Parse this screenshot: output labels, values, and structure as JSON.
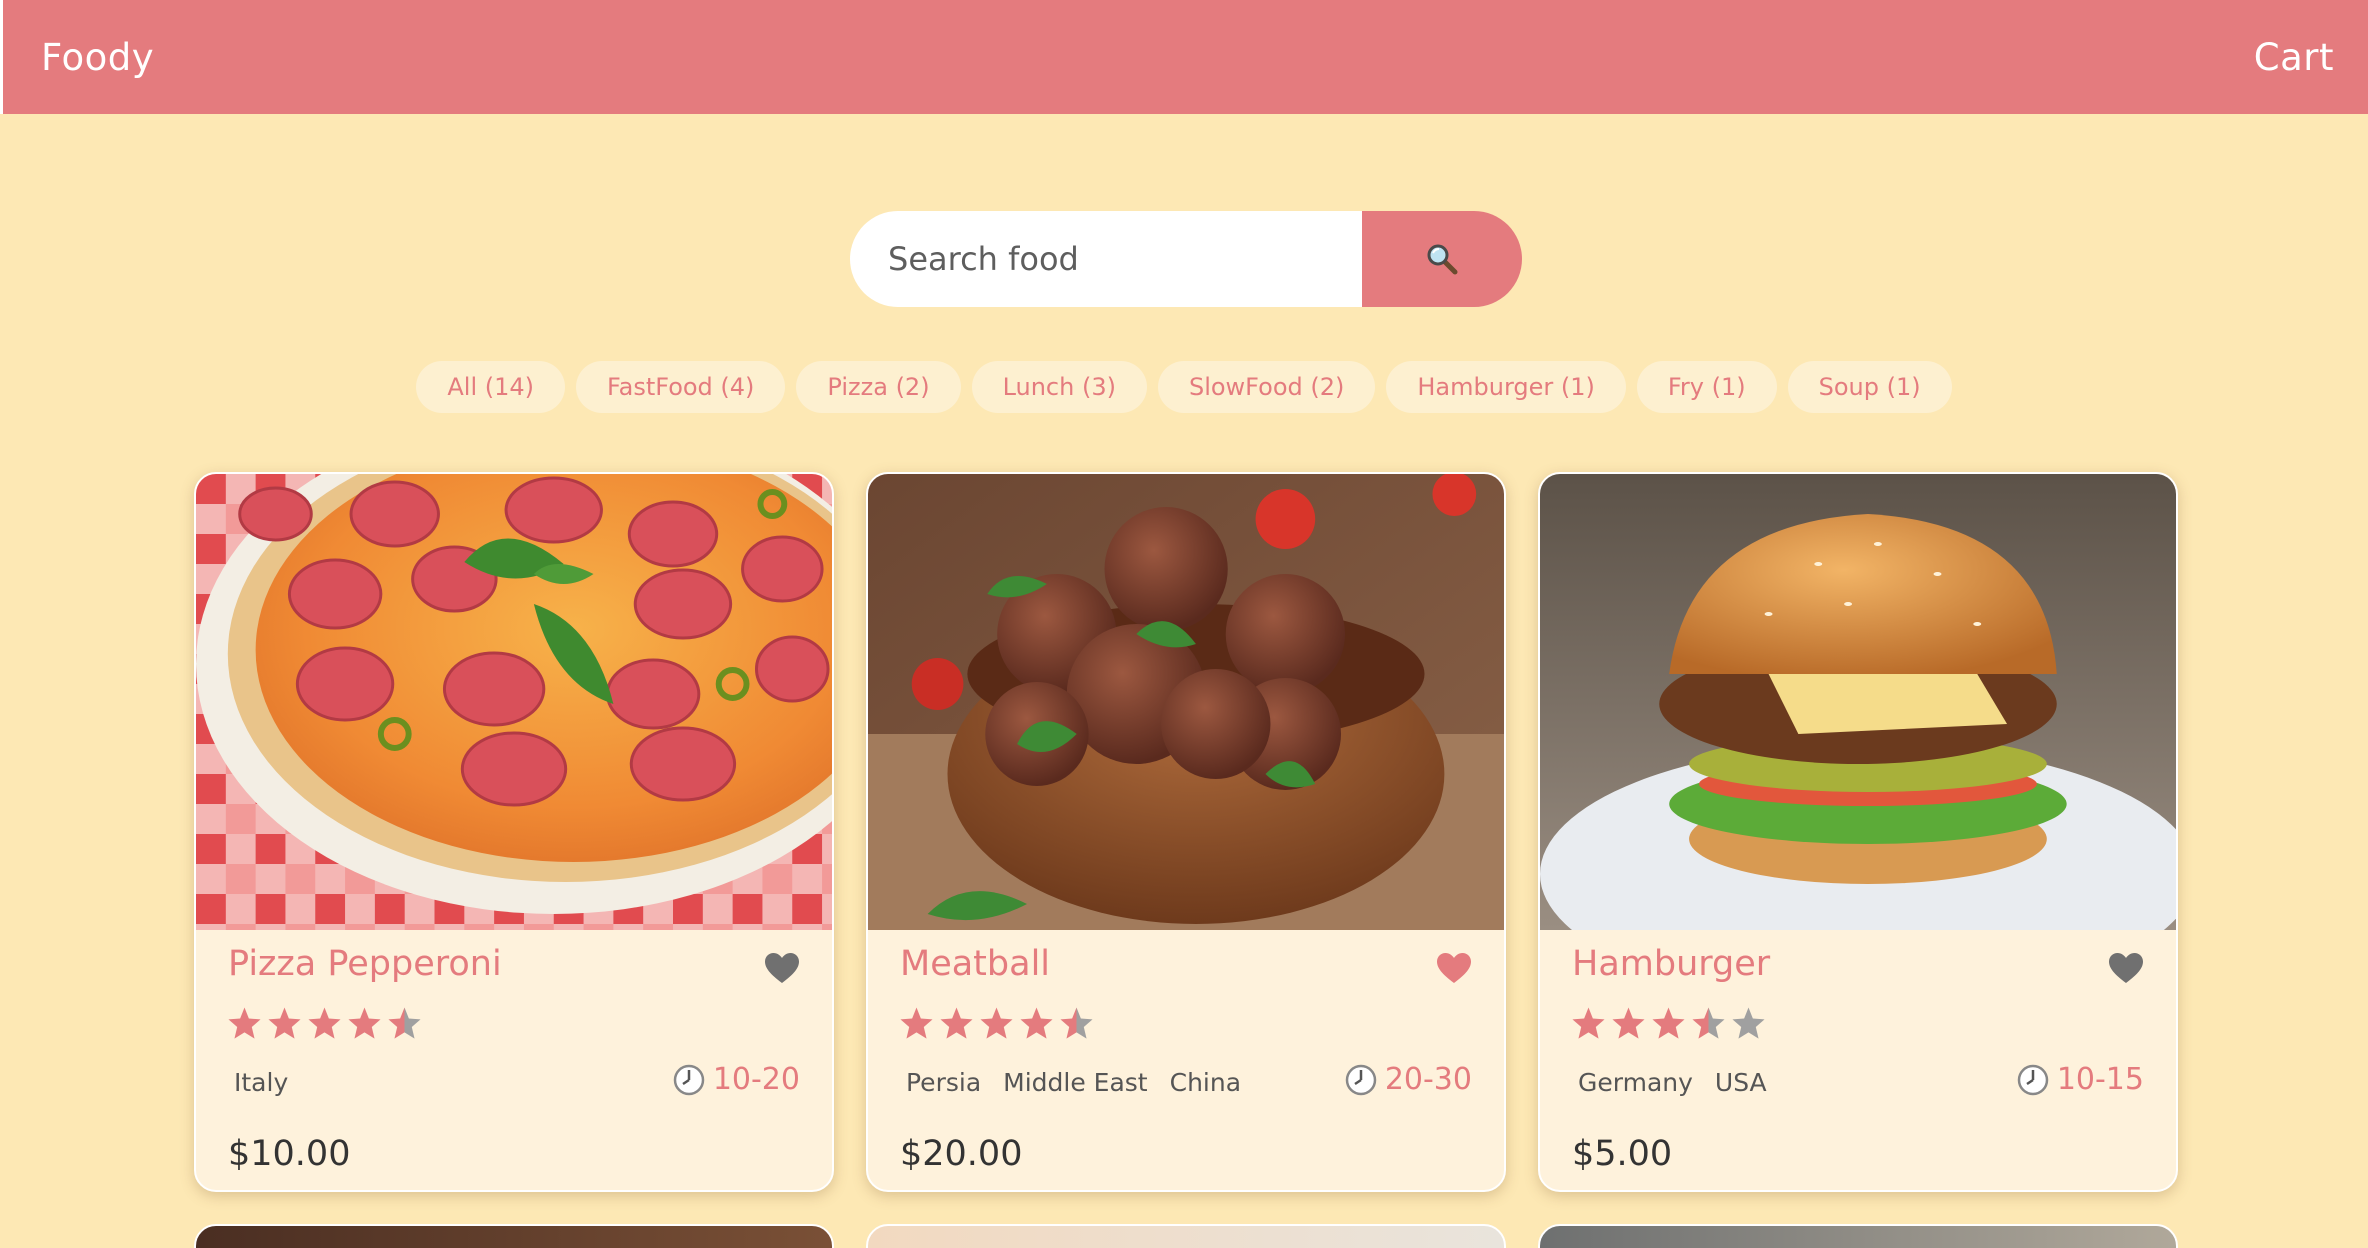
{
  "header": {
    "brand": "Foody",
    "cart_label": "Cart"
  },
  "search": {
    "placeholder": "Search food",
    "value": "",
    "button_icon": "magnifier-icon"
  },
  "tags": [
    {
      "label": "All (14)"
    },
    {
      "label": "FastFood (4)"
    },
    {
      "label": "Pizza (2)"
    },
    {
      "label": "Lunch (3)"
    },
    {
      "label": "SlowFood (2)"
    },
    {
      "label": "Hamburger (1)"
    },
    {
      "label": "Fry (1)"
    },
    {
      "label": "Soup (1)"
    }
  ],
  "foods": [
    {
      "name": "Pizza Pepperoni",
      "favorite": false,
      "rating": 4.5,
      "origins": [
        "Italy"
      ],
      "cook_time": "10-20",
      "price": "$10.00",
      "image": "pizza-pepperoni-photo"
    },
    {
      "name": "Meatball",
      "favorite": true,
      "rating": 4.5,
      "origins": [
        "Persia",
        "Middle East",
        "China"
      ],
      "cook_time": "20-30",
      "price": "$20.00",
      "image": "meatball-photo"
    },
    {
      "name": "Hamburger",
      "favorite": false,
      "rating": 3.5,
      "origins": [
        "Germany",
        "USA"
      ],
      "cook_time": "10-15",
      "price": "$5.00",
      "image": "hamburger-photo"
    }
  ],
  "colors": {
    "accent": "#e47b7e",
    "background": "#fde8b4",
    "card": "#fef2dc",
    "tag_background": "#fdf0d0",
    "star_empty": "#a0a0a0",
    "heart_inactive": "#707070"
  }
}
